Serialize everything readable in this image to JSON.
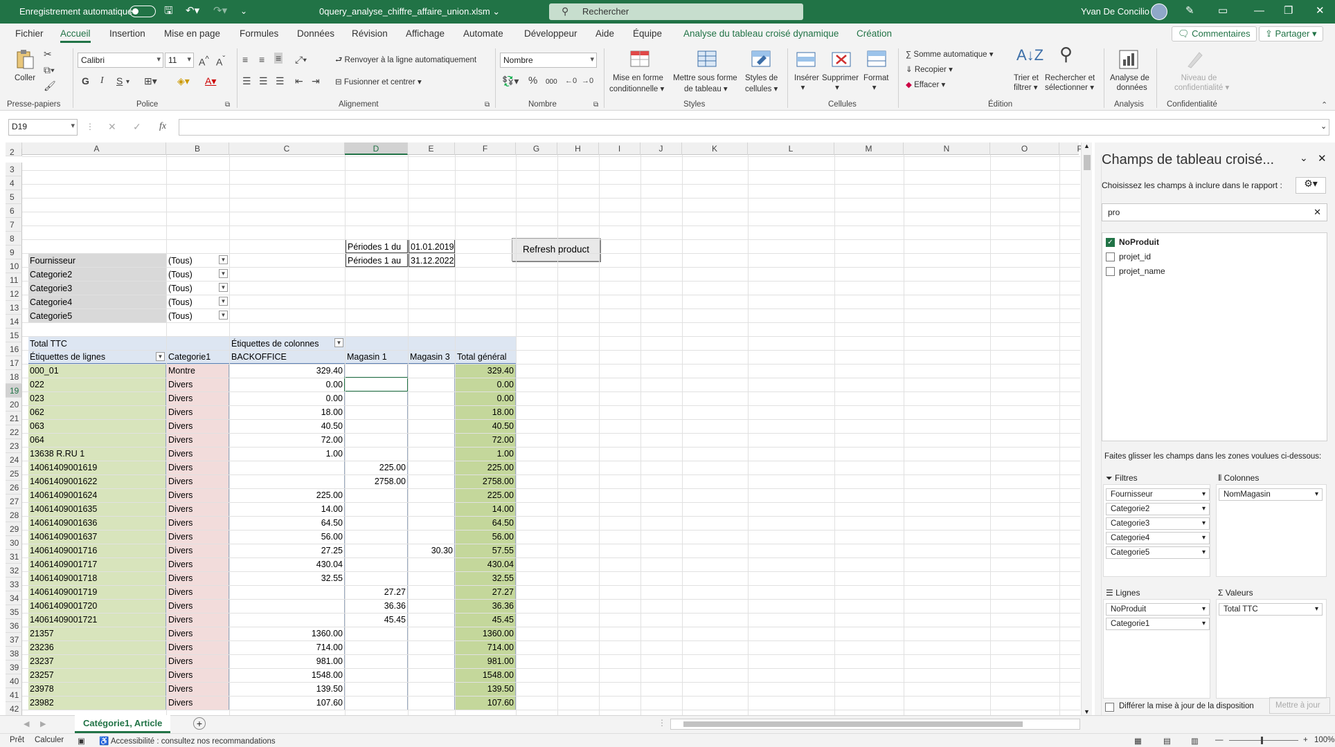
{
  "titlebar": {
    "autosave": "Enregistrement automatique",
    "filename": "0query_analyse_chiffre_affaire_union.xlsm",
    "search_placeholder": "Rechercher",
    "user": "Yvan De Concilio",
    "accent": "#217346"
  },
  "tabs": [
    "Fichier",
    "Accueil",
    "Insertion",
    "Mise en page",
    "Formules",
    "Données",
    "Révision",
    "Affichage",
    "Automate",
    "Développeur",
    "Aide",
    "Équipe",
    "Analyse du tableau croisé dynamique",
    "Création"
  ],
  "top_buttons": {
    "comments": "Commentaires",
    "share": "Partager"
  },
  "ribbon": {
    "clipboard": {
      "paste": "Coller",
      "label": "Presse-papiers"
    },
    "font": {
      "name": "Calibri",
      "size": "11",
      "label": "Police",
      "bold": "G",
      "italic": "I",
      "underline": "S"
    },
    "alignment": {
      "wrap": "Renvoyer à la ligne automatiquement",
      "merge": "Fusionner et centrer",
      "label": "Alignement"
    },
    "number": {
      "format": "Nombre",
      "label": "Nombre",
      "percent": "%",
      "thousands": "000"
    },
    "styles": {
      "cond1": "Mise en forme",
      "cond2": "conditionnelle",
      "table1": "Mettre sous forme",
      "table2": "de tableau",
      "cell1": "Styles de",
      "cell2": "cellules",
      "label": "Styles"
    },
    "cells": {
      "insert": "Insérer",
      "delete": "Supprimer",
      "format": "Format",
      "label": "Cellules"
    },
    "editing": {
      "autosum": "Somme automatique",
      "fill": "Recopier",
      "clear": "Effacer",
      "sort1": "Trier et",
      "sort2": "filtrer",
      "find1": "Rechercher et",
      "find2": "sélectionner",
      "label": "Édition"
    },
    "analysis": {
      "t1": "Analyse de",
      "t2": "données",
      "label": "Analysis"
    },
    "sensitivity": {
      "t1": "Niveau de",
      "t2": "confidentialité",
      "label": "Confidentialité"
    }
  },
  "formula_bar": {
    "namebox": "D19",
    "value": ""
  },
  "columns": [
    "A",
    "B",
    "C",
    "D",
    "E",
    "F",
    "G",
    "H",
    "I",
    "J",
    "K",
    "L",
    "M",
    "N",
    "O",
    "P"
  ],
  "rows": [
    "2",
    "3",
    "4",
    "5",
    "6",
    "7",
    "8",
    "9",
    "10",
    "11",
    "12",
    "13",
    "14",
    "15",
    "16",
    "17",
    "18",
    "19",
    "20",
    "21",
    "22",
    "23",
    "24",
    "25",
    "26",
    "27",
    "28",
    "29",
    "30",
    "31",
    "32",
    "33",
    "34",
    "35",
    "36",
    "37",
    "38",
    "39",
    "40",
    "41",
    "42"
  ],
  "periods": {
    "label1": "Périodes 1 du",
    "date1": "01.01.2019",
    "label2": "Périodes 1 au",
    "date2": "31.12.2022",
    "refresh_button": "Refresh product"
  },
  "filters": [
    {
      "field": "Fournisseur",
      "value": "(Tous)"
    },
    {
      "field": "Categorie2",
      "value": "(Tous)"
    },
    {
      "field": "Categorie3",
      "value": "(Tous)"
    },
    {
      "field": "Categorie4",
      "value": "(Tous)"
    },
    {
      "field": "Categorie5",
      "value": "(Tous)"
    }
  ],
  "pivot": {
    "corner": "Total TTC",
    "col_labels": "Étiquettes de colonnes",
    "headers": [
      "Étiquettes de lignes",
      "Categorie1",
      "BACKOFFICE",
      "Magasin 1",
      "Magasin 3",
      "Total général"
    ],
    "rows": [
      [
        "000_01",
        "Montre",
        "329.40",
        "",
        "",
        "329.40"
      ],
      [
        "022",
        "Divers",
        "0.00",
        "",
        "",
        "0.00"
      ],
      [
        "023",
        "Divers",
        "0.00",
        "",
        "",
        "0.00"
      ],
      [
        "062",
        "Divers",
        "18.00",
        "",
        "",
        "18.00"
      ],
      [
        "063",
        "Divers",
        "40.50",
        "",
        "",
        "40.50"
      ],
      [
        "064",
        "Divers",
        "72.00",
        "",
        "",
        "72.00"
      ],
      [
        "13638 R.RU 1",
        "Divers",
        "1.00",
        "",
        "",
        "1.00"
      ],
      [
        "14061409001619",
        "Divers",
        "",
        "225.00",
        "",
        "225.00"
      ],
      [
        "14061409001622",
        "Divers",
        "",
        "2758.00",
        "",
        "2758.00"
      ],
      [
        "14061409001624",
        "Divers",
        "225.00",
        "",
        "",
        "225.00"
      ],
      [
        "14061409001635",
        "Divers",
        "14.00",
        "",
        "",
        "14.00"
      ],
      [
        "14061409001636",
        "Divers",
        "64.50",
        "",
        "",
        "64.50"
      ],
      [
        "14061409001637",
        "Divers",
        "56.00",
        "",
        "",
        "56.00"
      ],
      [
        "14061409001716",
        "Divers",
        "27.25",
        "",
        "30.30",
        "57.55"
      ],
      [
        "14061409001717",
        "Divers",
        "430.04",
        "",
        "",
        "430.04"
      ],
      [
        "14061409001718",
        "Divers",
        "32.55",
        "",
        "",
        "32.55"
      ],
      [
        "14061409001719",
        "Divers",
        "",
        "27.27",
        "",
        "27.27"
      ],
      [
        "14061409001720",
        "Divers",
        "",
        "36.36",
        "",
        "36.36"
      ],
      [
        "14061409001721",
        "Divers",
        "",
        "45.45",
        "",
        "45.45"
      ],
      [
        "21357",
        "Divers",
        "1360.00",
        "",
        "",
        "1360.00"
      ],
      [
        "23236",
        "Divers",
        "714.00",
        "",
        "",
        "714.00"
      ],
      [
        "23237",
        "Divers",
        "981.00",
        "",
        "",
        "981.00"
      ],
      [
        "23257",
        "Divers",
        "1548.00",
        "",
        "",
        "1548.00"
      ],
      [
        "23978",
        "Divers",
        "139.50",
        "",
        "",
        "139.50"
      ],
      [
        "23982",
        "Divers",
        "107.60",
        "",
        "",
        "107.60"
      ]
    ]
  },
  "pane": {
    "title": "Champs de tableau croisé...",
    "subtitle": "Choisissez les champs à inclure dans le rapport :",
    "search": "pro",
    "fields": [
      {
        "name": "NoProduit",
        "checked": true
      },
      {
        "name": "projet_id",
        "checked": false
      },
      {
        "name": "projet_name",
        "checked": false
      }
    ],
    "drag_hint": "Faites glisser les champs dans les zones voulues ci-dessous:",
    "areas": {
      "filters": "Filtres",
      "columns": "Colonnes",
      "rows": "Lignes",
      "values": "Valeurs"
    },
    "filter_items": [
      "Fournisseur",
      "Categorie2",
      "Categorie3",
      "Categorie4",
      "Categorie5"
    ],
    "column_items": [
      "NomMagasin"
    ],
    "row_items": [
      "NoProduit",
      "Categorie1"
    ],
    "value_items": [
      "Total TTC"
    ],
    "defer": "Différer la mise à jour de la disposition",
    "update": "Mettre à jour"
  },
  "sheet_tab": "Catégorie1, Article",
  "status": {
    "ready": "Prêt",
    "calc": "Calculer",
    "accessibility": "Accessibilité : consultez nos recommandations",
    "zoom": "100%"
  }
}
